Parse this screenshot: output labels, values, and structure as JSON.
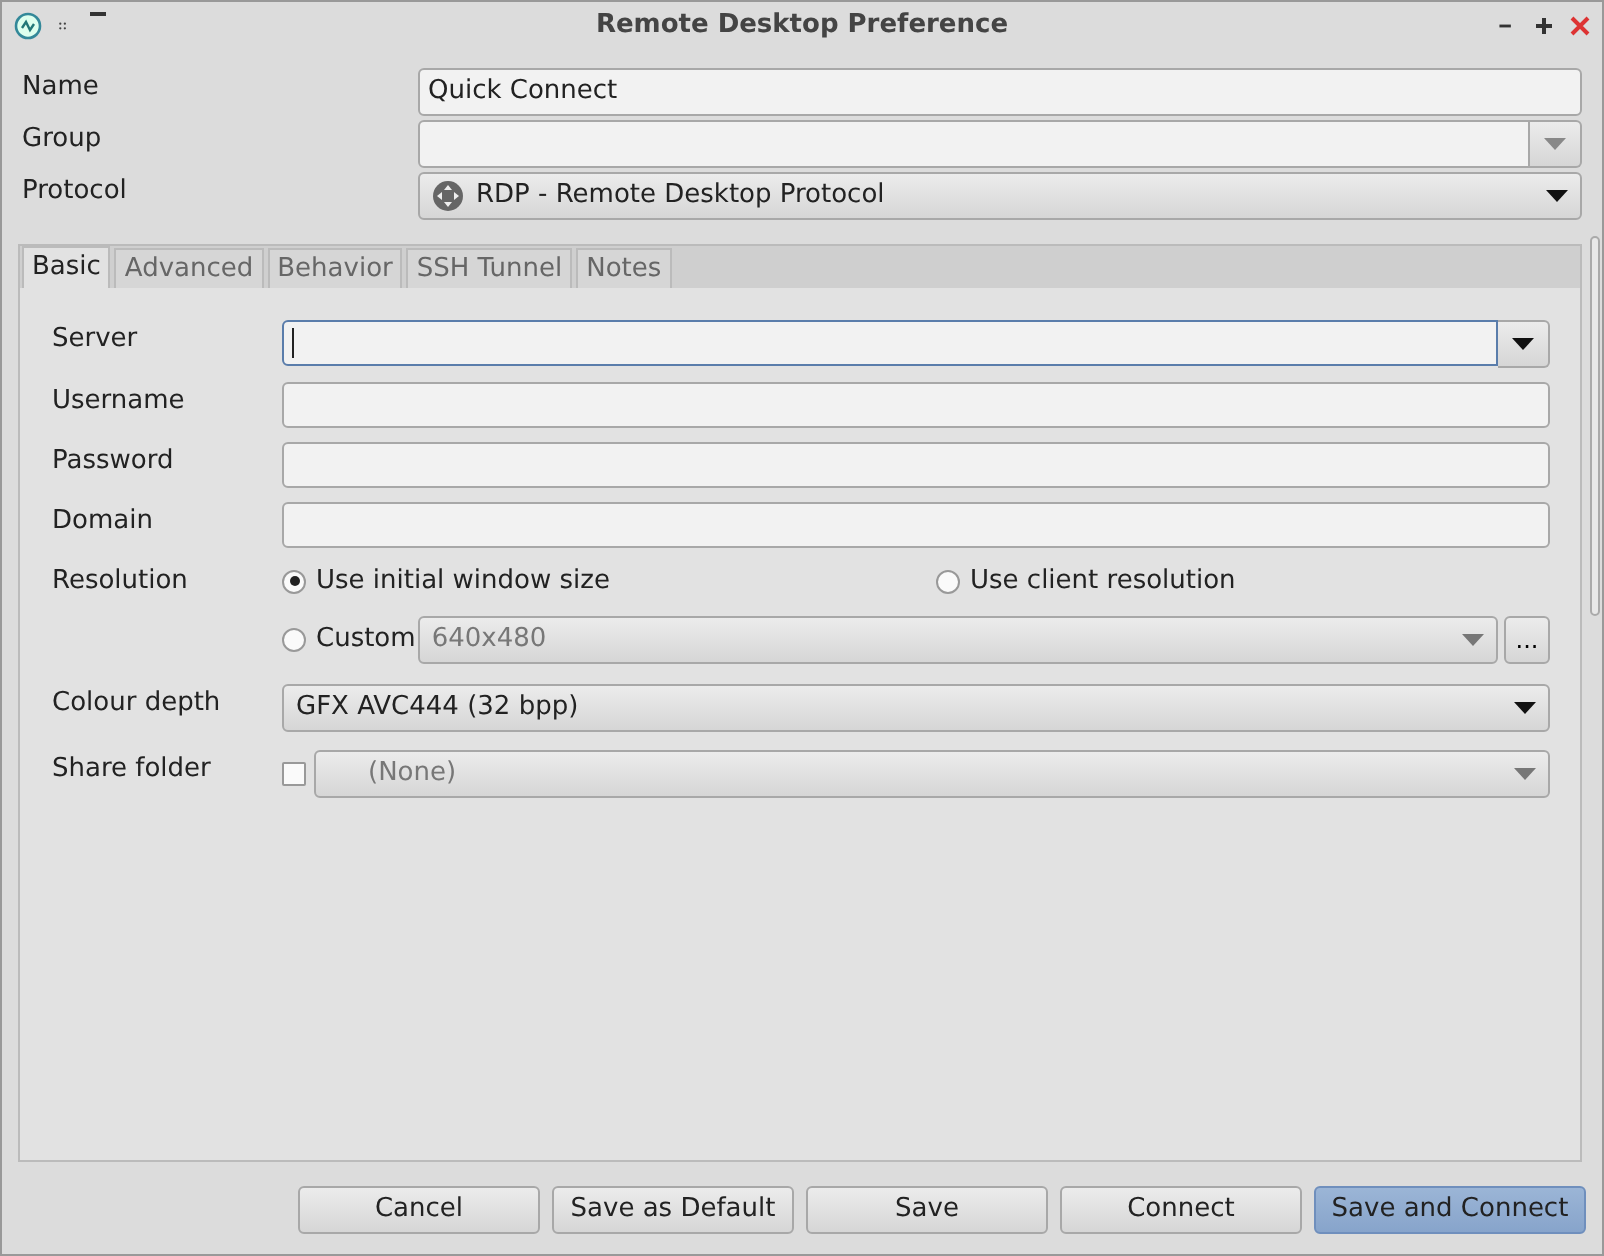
{
  "window": {
    "title": "Remote Desktop Preference"
  },
  "top_fields": [
    {
      "label": "Name",
      "kind": "text",
      "value": "Quick Connect"
    },
    {
      "label": "Group",
      "kind": "combo"
    },
    {
      "label": "Protocol",
      "kind": "select",
      "value": "RDP - Remote Desktop Protocol"
    }
  ],
  "tabs": [
    {
      "label": "Basic",
      "selected": true
    },
    {
      "label": "Advanced",
      "selected": false
    },
    {
      "label": "Behavior",
      "selected": false
    },
    {
      "label": "SSH Tunnel",
      "selected": false
    },
    {
      "label": "Notes",
      "selected": false
    }
  ],
  "basic": {
    "fields": [
      {
        "label": "Server",
        "kind": "combo",
        "focused": true
      },
      {
        "label": "Username",
        "kind": "text",
        "focused": false
      },
      {
        "label": "Password",
        "kind": "text",
        "focused": false
      },
      {
        "label": "Domain",
        "kind": "text",
        "focused": false
      }
    ],
    "resolution": {
      "label": "Resolution",
      "options": [
        {
          "label": "Use initial window size",
          "selected": true
        },
        {
          "label": "Use client resolution",
          "selected": false
        },
        {
          "label": "Custom",
          "selected": false
        }
      ],
      "custom_value": "640x480",
      "custom_disabled": true,
      "more_button": "..."
    },
    "colour_depth": {
      "label": "Colour depth",
      "value": "GFX AVC444 (32 bpp)"
    },
    "share_folder": {
      "label": "Share folder",
      "checked": false,
      "value": "(None)",
      "disabled": true
    }
  },
  "buttons": [
    {
      "label": "Cancel",
      "default": false
    },
    {
      "label": "Save as Default",
      "default": false
    },
    {
      "label": "Save",
      "default": false
    },
    {
      "label": "Connect",
      "default": false
    },
    {
      "label": "Save and Connect",
      "default": true
    }
  ]
}
